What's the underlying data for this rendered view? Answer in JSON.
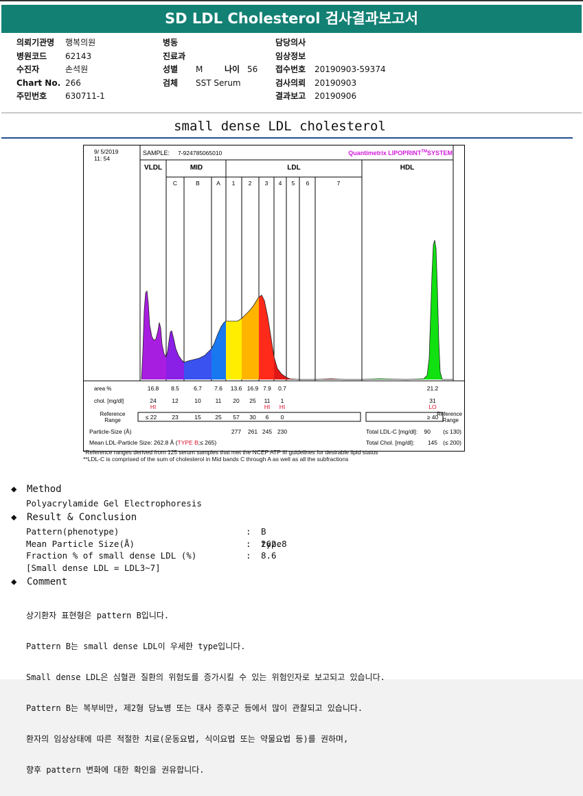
{
  "report": {
    "title": "SD LDL Cholesterol 검사결과보고서",
    "subtitle": "small dense LDL cholesterol"
  },
  "patient_info": {
    "col1": [
      {
        "label": "의뢰기관명",
        "value": "행복의원"
      },
      {
        "label": "병원코드",
        "value": "62143"
      },
      {
        "label": "수진자",
        "value": "손석원"
      },
      {
        "label": "Chart No.",
        "value": "266"
      },
      {
        "label": "주민번호",
        "value": "630711-1"
      }
    ],
    "col2": [
      {
        "label": "병동",
        "value": ""
      },
      {
        "label": "진료과",
        "value": ""
      },
      {
        "label": "성별",
        "value": "M"
      },
      {
        "label": "검체",
        "value": "SST Serum"
      }
    ],
    "age": {
      "label": "나이",
      "value": "56"
    },
    "col3": [
      {
        "label": "담당의사",
        "value": ""
      },
      {
        "label": "임상정보",
        "value": ""
      },
      {
        "label": "접수번호",
        "value": "20190903-59374"
      },
      {
        "label": "검사의뢰",
        "value": "20190903"
      },
      {
        "label": "결과보고",
        "value": "20190906"
      }
    ]
  },
  "chart_data": {
    "type": "area",
    "date": "9/ 5/2019",
    "time": "11: 54",
    "sample_label": "SAMPLE:",
    "sample_id": "7-924785065010",
    "brand": "Quantimetrix LIPOPRINT",
    "brand_tm": "TM",
    "brand_suffix": "SYSTEM",
    "groups": [
      "VLDL",
      "MID",
      "LDL",
      "HDL"
    ],
    "bands": [
      "C",
      "B",
      "A",
      "1",
      "2",
      "3",
      "4",
      "5",
      "6",
      "7"
    ],
    "fractions": [
      "VLDL",
      "C",
      "B",
      "A",
      "1",
      "2",
      "3",
      "4",
      "5",
      "6",
      "7",
      "HDL"
    ],
    "area_label": "area %",
    "area": [
      "16.8",
      "8.5",
      "6.7",
      "7.6",
      "13.6",
      "16.9",
      "7.9",
      "0.7",
      "",
      "",
      "",
      "21.2"
    ],
    "chol_label": "chol. [mg/dl]",
    "chol": [
      "24",
      "12",
      "10",
      "11",
      "20",
      "25",
      "11",
      "1",
      "",
      "",
      "",
      "31"
    ],
    "flags": [
      "HI",
      "",
      "",
      "",
      "",
      "",
      "HI",
      "HI",
      "",
      "",
      "",
      "LO"
    ],
    "ref_label_1": "Reference",
    "ref_label_2": "Range",
    "ref": [
      "≤ 22",
      "23",
      "15",
      "25",
      "57",
      "30",
      "6",
      "0",
      "",
      "",
      "",
      "≥ 40"
    ],
    "particle_label": "Particle-Size (Å)",
    "particle_size": [
      "",
      "",
      "",
      "",
      "277",
      "261",
      "245",
      "230",
      "",
      "",
      "",
      ""
    ],
    "mean_ldl_label": "Mean LDL-Particle Size:",
    "mean_ldl_value": "262.8 Å",
    "type_open": "(",
    "type_label": "TYPE B",
    "type_ref": ";≤ 265)",
    "total_ldl_label": "Total LDL-C [mg/dl]:",
    "total_ldl_value": "90",
    "total_ldl_ref": "(≤ 130)",
    "total_chol_label": "Total Chol. [mg/dl]:",
    "total_chol_value": "145",
    "total_chol_ref": "(≤ 200)",
    "footnotes": [
      "*Reference ranges derived from 125 serum samples that met the NCEP ATP III guidelines for desirable lipid status",
      "**LDL-C is comprised of the sum of cholesterol in Mid bands C through A as well as all the subfractions"
    ],
    "fraction_colors": {
      "VLDL": "#a81ee0",
      "C": "#8a1fe6",
      "B": "#3a52f0",
      "A": "#1878f0",
      "1": "#ffee00",
      "2": "#ffb400",
      "3": "#ff2a1a",
      "4": "#e01818",
      "5": "#d01010",
      "6": "#c81010",
      "7": "#b41010",
      "HDL": "#11e011"
    }
  },
  "method": {
    "heading": "Method",
    "text": "Polyacrylamide Gel Electrophoresis"
  },
  "result": {
    "heading": "Result & Conclusion",
    "rows": [
      {
        "label": "Pattern(phenotype)",
        "value": "B type"
      },
      {
        "label": "Mean Particle Size(Å)",
        "value": "262.8"
      },
      {
        "label": "Fraction % of small dense LDL (%)",
        "value": "8.6"
      }
    ],
    "note": "[Small dense LDL = LDL3~7]",
    "colon": ":"
  },
  "comment": {
    "heading": "Comment",
    "lines": [
      "상기환자 표현형은 pattern B입니다.",
      "Pattern B는 small dense LDL이 우세한 type입니다.",
      "Small dense LDL은 심혈관 질환의 위험도를 증가시킬 수 있는 위험인자로 보고되고 있습니다.",
      "Pattern B는 복부비만, 제2형 당뇨병 또는 대사 증후군 등에서 많이 관찰되고 있습니다.",
      "환자의 임상상태에 따른 적절한 치료(운동요법, 식이요법 또는 약물요법 등)를 권하며,",
      "향후 pattern 변화에 대한 확인을 권유합니다."
    ]
  },
  "icons": {
    "bullet": "diamond-icon"
  }
}
